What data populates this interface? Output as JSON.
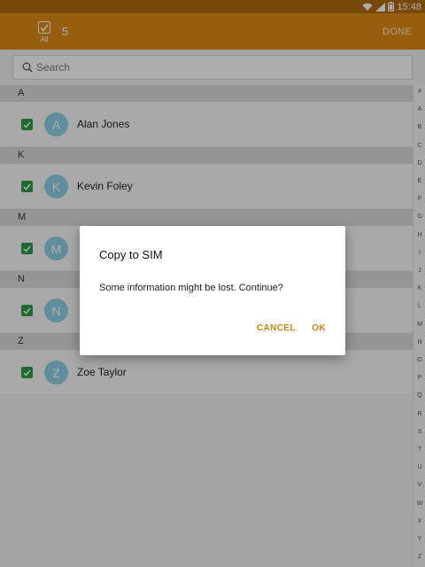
{
  "status_bar": {
    "time": "15:48",
    "icons": [
      "wifi-icon",
      "signal-icon",
      "battery-icon"
    ]
  },
  "app_bar": {
    "select_all_label": "All",
    "selected_count": "5",
    "done_label": "DONE"
  },
  "search": {
    "placeholder": "Search"
  },
  "sections": [
    {
      "letter": "A",
      "contacts": [
        {
          "initial": "A",
          "name": "Alan Jones",
          "checked": true
        }
      ]
    },
    {
      "letter": "K",
      "contacts": [
        {
          "initial": "K",
          "name": "Kevin Foley",
          "checked": true
        }
      ]
    },
    {
      "letter": "M",
      "contacts": [
        {
          "initial": "M",
          "name": "",
          "checked": true
        }
      ]
    },
    {
      "letter": "N",
      "contacts": [
        {
          "initial": "N",
          "name": "",
          "checked": true
        }
      ]
    },
    {
      "letter": "Z",
      "contacts": [
        {
          "initial": "Z",
          "name": "Zoe Taylor",
          "checked": true
        }
      ]
    }
  ],
  "index_bar": [
    "#",
    "A",
    "B",
    "C",
    "D",
    "E",
    "F",
    "G",
    "H",
    "I",
    "J",
    "K",
    "L",
    "M",
    "N",
    "O",
    "P",
    "Q",
    "R",
    "S",
    "T",
    "U",
    "V",
    "W",
    "X",
    "Y",
    "Z"
  ],
  "dialog": {
    "title": "Copy to SIM",
    "message": "Some information might be lost. Continue?",
    "cancel_label": "CANCEL",
    "ok_label": "OK"
  },
  "colors": {
    "app_bar": "#e08b18",
    "status_bar": "#b06a0c",
    "checkbox": "#2e9c4a",
    "avatar": "#8ed2e8",
    "dialog_button": "#d3850f"
  }
}
